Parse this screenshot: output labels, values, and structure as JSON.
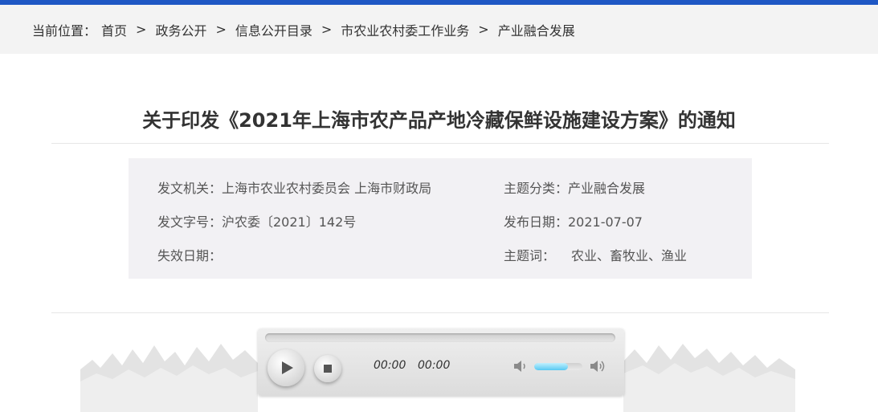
{
  "breadcrumb": {
    "prefix": "当前位置：",
    "items": [
      "首页",
      "政务公开",
      "信息公开目录",
      "市农业农村委工作业务",
      "产业融合发展"
    ],
    "separator": ">"
  },
  "article": {
    "title": "关于印发《2021年上海市农产品产地冷藏保鲜设施建设方案》的通知"
  },
  "meta": {
    "issuer": "发文机关：上海市农业农村委员会 上海市财政局",
    "category": "主题分类：产业融合发展",
    "doc_number": "发文字号：沪农委〔2021〕142号",
    "publish_date": "发布日期：2021-07-07",
    "expiry": "失效日期：",
    "keywords": "主题词：",
    "keywords_value": "农业、畜牧业、渔业"
  },
  "player": {
    "current_time": "00:00",
    "duration": "00:00",
    "volume": 0.7,
    "icons": [
      "play-icon",
      "stop-icon",
      "volume-low-icon",
      "volume-high-icon"
    ]
  },
  "colors": {
    "top_bar": "#1e57c4",
    "breadcrumb_bg": "#f3f3f3",
    "meta_bg": "#f2f1f4",
    "volume_fill": "#59c9f2"
  }
}
